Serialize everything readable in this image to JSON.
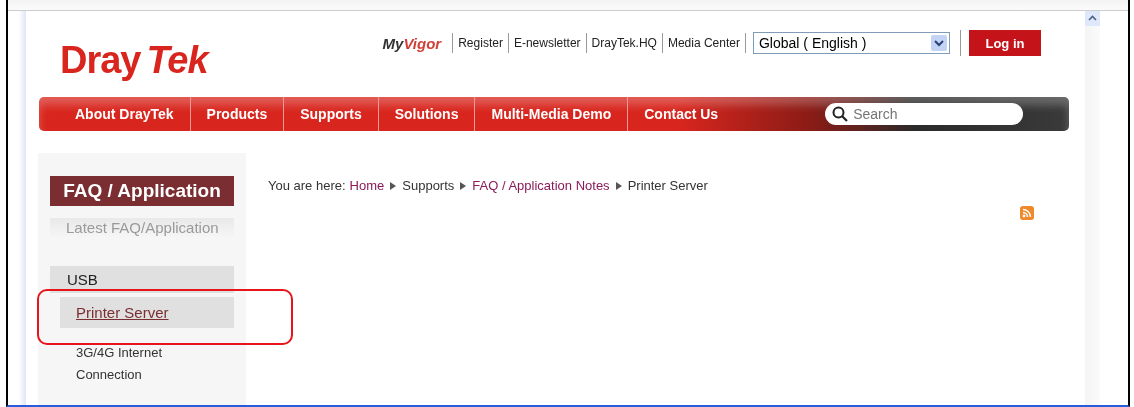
{
  "header": {
    "logo": [
      "Dray",
      "Tek"
    ],
    "myvigor": [
      "My",
      "Vigor"
    ],
    "top_links": [
      "Register",
      "E-newsletter",
      "DrayTek.HQ",
      "Media Center"
    ],
    "language_select": {
      "value": "Global ( English )"
    },
    "login_button": "Log in"
  },
  "nav": {
    "items": [
      {
        "label": "About DrayTek",
        "selected": false
      },
      {
        "label": "Products",
        "selected": false
      },
      {
        "label": "Supports",
        "selected": false
      },
      {
        "label": "Solutions",
        "selected": false
      },
      {
        "label": "Multi-Media Demo",
        "selected": false
      },
      {
        "label": "Contact Us",
        "selected": false
      }
    ],
    "search": {
      "placeholder": "Search"
    }
  },
  "sidebar": {
    "heading": "FAQ / Application",
    "faded_item": "Latest FAQ/Application",
    "categories": [
      {
        "label": "USB",
        "children": [
          {
            "label": "Printer Server",
            "selected": true,
            "annotated": true
          },
          {
            "label": "3G/4G Internet Connection",
            "selected": false,
            "annotated": false
          }
        ]
      }
    ]
  },
  "breadcrumb": {
    "prefix": "You are here:",
    "items": [
      {
        "label": "Home",
        "kind": "link"
      },
      {
        "label": "Supports",
        "kind": "plain"
      },
      {
        "label": "FAQ / Application Notes",
        "kind": "link"
      },
      {
        "label": "Printer Server",
        "kind": "plain"
      }
    ]
  }
}
